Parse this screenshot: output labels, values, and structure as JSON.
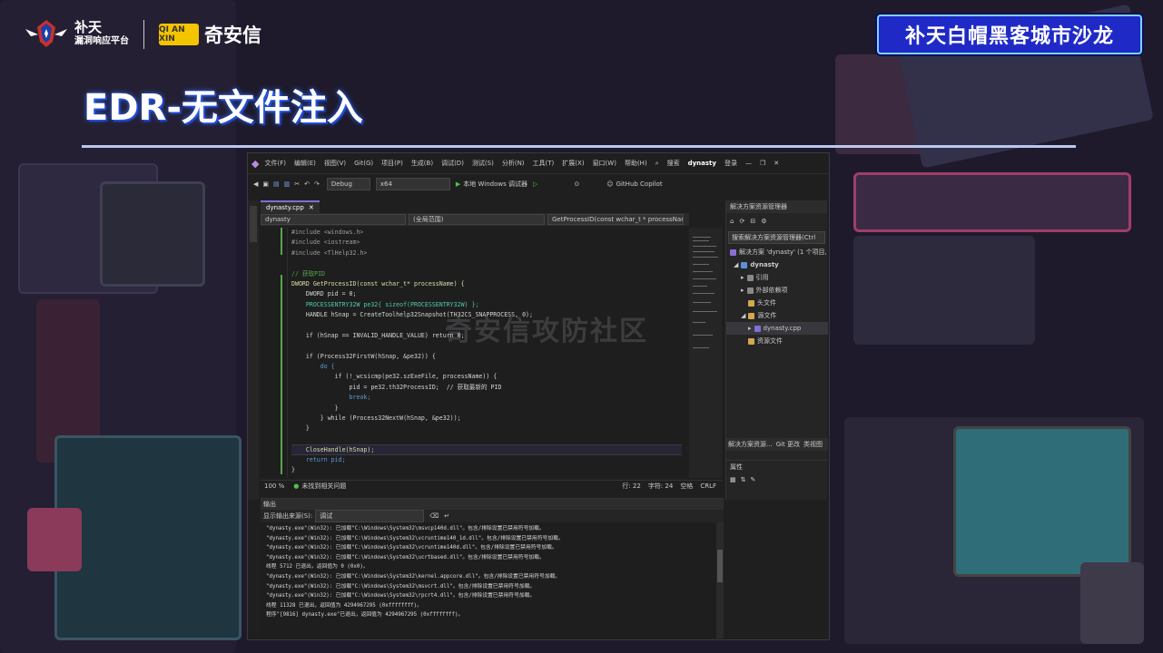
{
  "header": {
    "brand1_line1": "补天",
    "brand1_line2": "漏洞响应平台",
    "brand2_mark": "QI AN XIN",
    "brand2_name": "奇安信",
    "salon": "补天白帽黑客城市沙龙"
  },
  "slide_title": "EDR-无文件注入",
  "watermark": "奇安信攻防社区",
  "ide": {
    "menu": [
      "文件(F)",
      "编辑(E)",
      "视图(V)",
      "Git(G)",
      "项目(P)",
      "生成(B)",
      "调试(D)",
      "测试(S)",
      "分析(N)",
      "工具(T)",
      "扩展(X)",
      "窗口(W)",
      "帮助(H)"
    ],
    "search_label": "搜索",
    "solution_name": "dynasty",
    "login": "登录",
    "copilot": "GitHub Copilot",
    "config": "Debug",
    "platform": "x64",
    "run_label": "本地 Windows 调试器",
    "file_tab": "dynasty.cpp",
    "nav_project": "dynasty",
    "nav_scope": "(全局范围)",
    "nav_function": "GetProcessID(const wchar_t * processName",
    "code_lines": [
      "#include <windows.h>",
      "#include <iostream>",
      "#include <TlHelp32.h>",
      "",
      "// 获取PID",
      "DWORD GetProcessID(const wchar_t* processName) {",
      "    DWORD pid = 0;",
      "    PROCESSENTRY32W pe32{ sizeof(PROCESSENTRY32W) };",
      "    HANDLE hSnap = CreateToolhelp32Snapshot(TH32CS_SNAPPROCESS, 0);",
      "",
      "    if (hSnap == INVALID_HANDLE_VALUE) return 0;",
      "",
      "    if (Process32FirstW(hSnap, &pe32)) {",
      "        do {",
      "            if (!_wcsicmp(pe32.szExeFile, processName)) {",
      "                pid = pe32.th32ProcessID;  // 获取最新的 PID",
      "                break;",
      "            }",
      "        } while (Process32NextW(hSnap, &pe32));",
      "    }",
      "",
      "    CloseHandle(hSnap);",
      "    return pid;",
      "}"
    ],
    "status": {
      "zoom": "100 %",
      "issues": "未找到相关问题",
      "line": "行: 22",
      "char": "字符: 24",
      "spaces": "空格",
      "eol": "CRLF"
    },
    "solution_explorer": {
      "title": "解决方案资源管理器",
      "search": "搜索解决方案资源管理器(Ctrl",
      "items": [
        "解决方案 'dynasty' (1 个项目,",
        "dynasty",
        "引用",
        "外部依赖项",
        "头文件",
        "源文件",
        "dynasty.cpp",
        "资源文件"
      ],
      "bottom_tabs": [
        "解决方案资源...",
        "Git 更改",
        "类视图"
      ],
      "properties": "属性"
    },
    "output": {
      "title": "输出",
      "source_label": "显示输出来源(S):",
      "source_value": "调试",
      "lines": [
        "\"dynasty.exe\"(Win32): 已加载\"C:\\Windows\\System32\\msvcp140d.dll\"。包含/排除设置已禁用符号加载。",
        "\"dynasty.exe\"(Win32): 已加载\"C:\\Windows\\System32\\vcruntime140_1d.dll\"。包含/排除设置已禁用符号加载。",
        "\"dynasty.exe\"(Win32): 已加载\"C:\\Windows\\System32\\vcruntime140d.dll\"。包含/排除设置已禁用符号加载。",
        "\"dynasty.exe\"(Win32): 已加载\"C:\\Windows\\System32\\ucrtbased.dll\"。包含/排除设置已禁用符号加载。",
        "线程 5712 已退出，返回值为 0 (0x0)。",
        "\"dynasty.exe\"(Win32): 已加载\"C:\\Windows\\System32\\kernel.appcore.dll\"。包含/排除设置已禁用符号加载。",
        "\"dynasty.exe\"(Win32): 已加载\"C:\\Windows\\System32\\msvcrt.dll\"。包含/排除设置已禁用符号加载。",
        "\"dynasty.exe\"(Win32): 已加载\"C:\\Windows\\System32\\rpcrt4.dll\"。包含/排除设置已禁用符号加载。",
        "线程 11328 已退出，返回值为 4294967295 (0xffffffff)。",
        "程序\"[9816] dynasty.exe\"已退出，返回值为 4294967295 (0xffffffff)。"
      ]
    }
  }
}
